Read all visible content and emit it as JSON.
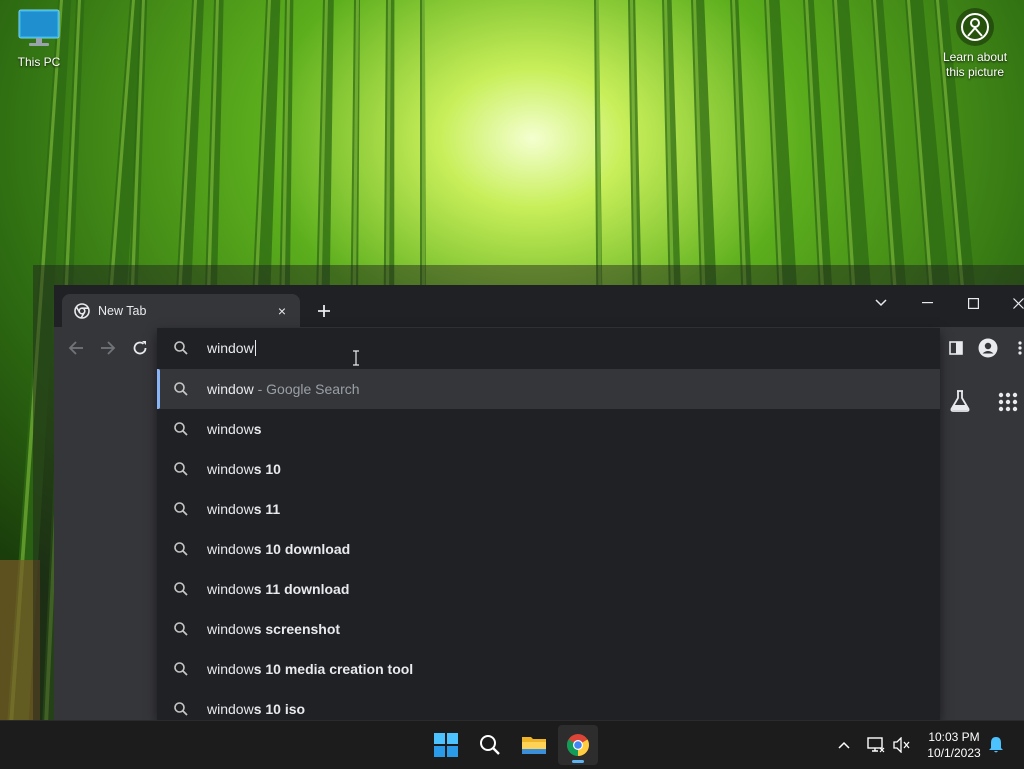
{
  "desktop": {
    "icons": [
      {
        "name": "This PC"
      }
    ],
    "spotlight": {
      "label_line1": "Learn about",
      "label_line2": "this picture"
    }
  },
  "browser": {
    "tab": {
      "title": "New Tab",
      "favicon": "chrome-icon",
      "close": "×"
    },
    "window_controls": [
      "tab-search-chevron-icon",
      "minimize-icon",
      "maximize-icon",
      "close-icon"
    ],
    "toolbar_icons": [
      "back-arrow-icon",
      "forward-arrow-icon",
      "reload-icon",
      "side-panel-icon",
      "profile-icon",
      "more-vert-icon"
    ],
    "content_icons": [
      "labs-flask-icon",
      "apps-grid-icon"
    ]
  },
  "omnibox": {
    "input_value": "window",
    "suggestions": [
      {
        "prefix": "window",
        "suffix": "",
        "hint": " - Google Search",
        "selected": true
      },
      {
        "prefix": "window",
        "suffix": "s",
        "hint": "",
        "selected": false
      },
      {
        "prefix": "window",
        "suffix": "s 10",
        "hint": "",
        "selected": false
      },
      {
        "prefix": "window",
        "suffix": "s 11",
        "hint": "",
        "selected": false
      },
      {
        "prefix": "window",
        "suffix": "s 10 download",
        "hint": "",
        "selected": false
      },
      {
        "prefix": "window",
        "suffix": "s 11 download",
        "hint": "",
        "selected": false
      },
      {
        "prefix": "window",
        "suffix": "s screenshot",
        "hint": "",
        "selected": false
      },
      {
        "prefix": "window",
        "suffix": "s 10 media creation tool",
        "hint": "",
        "selected": false
      },
      {
        "prefix": "window",
        "suffix": "s 10 iso",
        "hint": "",
        "selected": false
      }
    ]
  },
  "taskbar": {
    "apps": [
      "windows-start-icon",
      "search-icon",
      "file-explorer-icon",
      "chrome-icon"
    ],
    "tray": [
      "chevron-up-icon",
      "network-icon",
      "volume-muted-icon",
      "notification-bell-icon"
    ],
    "time": "10:03 PM",
    "date": "10/1/2023"
  },
  "colors": {
    "accent": "#8ab4f8",
    "taskbar_bg": "#1c1c1c",
    "dropdown_bg": "#202124",
    "toolbar_bg": "#35363a"
  }
}
